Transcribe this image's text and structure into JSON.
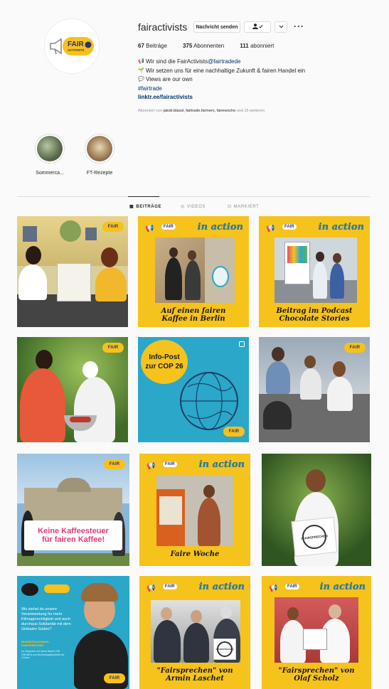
{
  "profile": {
    "username": "fairactivists",
    "logo_text": "FAIR",
    "logo_sub": "ACTIVISTS",
    "message_button": "Nachricht senden",
    "stats": {
      "posts_count": "67",
      "posts_label": "Beiträge",
      "followers_count": "375",
      "followers_label": "Abonnenten",
      "following_count": "111",
      "following_label": "abonniert"
    },
    "bio": {
      "line1_text": "Wir sind die FairActivists ",
      "line1_mention": "@fairtradede",
      "line2": "Wir setzen uns für eine nachhaltige Zukunft & fairen Handel ein",
      "line3": "Views are our own",
      "hashtag": "#fairtrade",
      "link": "linktr.ee/fairactivists"
    },
    "followed_prefix": "Abonniert von ",
    "followed_names": "jakob.blassl, fairtrade.farmers, fairewoche",
    "followed_suffix": " und 15 weiteren"
  },
  "highlights": [
    {
      "label": "Sommerca..."
    },
    {
      "label": "FT-Rezepte"
    }
  ],
  "tabs": {
    "posts": "BEITRÄGE",
    "videos": "VIDEOS",
    "tagged": "MARKIERT"
  },
  "posts": {
    "badge": "FAIR",
    "in_action": "in action",
    "p2_caption_1": "Auf einen fairen",
    "p2_caption_2": "Kaffee in Berlin",
    "p3_caption_1": "Beitrag im Podcast",
    "p3_caption_2": "Chocolate Stories",
    "p5_line1": "Info-Post",
    "p5_line2": "zur COP 26",
    "p7_banner_1": "Keine Kaffeesteuer",
    "p7_banner_2": "für fairen Kaffee!",
    "p8_caption": "Faire Woche",
    "p9_sign": "#FAIRSPRECHEN",
    "p10_question": "Wo siehst du unsere Verantwortung für mehr Klimagerechtigkeit und auch durchaus Solidarität mit dem Globalen Süden?",
    "p10_sub": "BUNDESTAGSWAHL FAIRSPRECHEN",
    "p10_small": "Im Gespräch mit Jakob Blasel, DIE GRÜNEN und Bundestagskandidat der Grünen",
    "p11_caption_1": "\"Fairsprechen\" von",
    "p11_caption_2": "Armin Laschet",
    "p12_caption_1": "\"Fairsprechen\" von",
    "p12_caption_2": "Olaf Scholz"
  },
  "colors": {
    "yellow": "#f6c21c",
    "blue": "#2aa7c9",
    "navy": "#2a3470",
    "link": "#00376b"
  }
}
